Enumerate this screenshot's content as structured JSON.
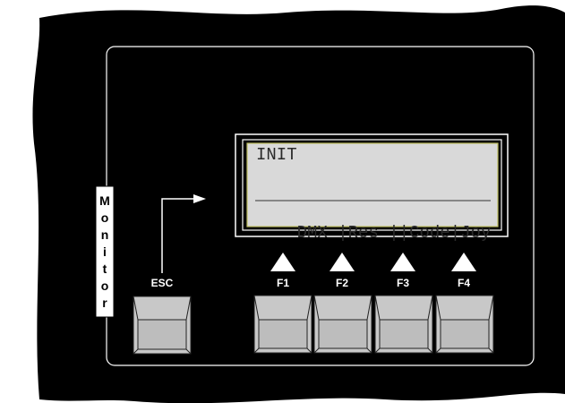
{
  "panel": {
    "side_label_letters": [
      "M",
      "o",
      "n",
      "i",
      "t",
      "o",
      "r"
    ]
  },
  "lcd": {
    "line1": "INIT",
    "menu": [
      "DMX",
      "Res",
      "",
      "Code",
      "Joy"
    ]
  },
  "keys": {
    "esc": "ESC",
    "f1": "F1",
    "f2": "F2",
    "f3": "F3",
    "f4": "F4"
  },
  "colors": {
    "panel": "#000000",
    "lcd_background": "#d9d9d9",
    "lcd_border": "#bfbf60",
    "key_face": "#c8c8c8",
    "key_label": "#ffffff"
  }
}
